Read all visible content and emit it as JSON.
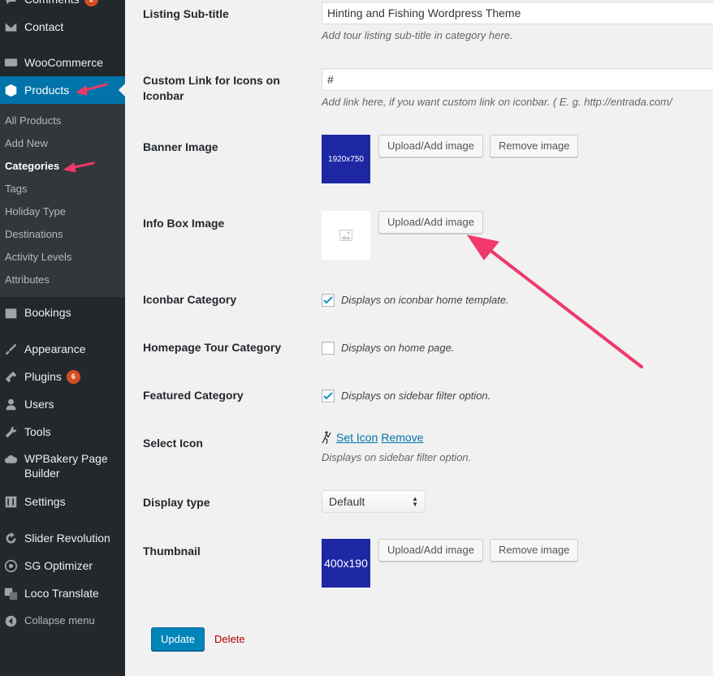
{
  "sidebar": {
    "items": [
      {
        "label": "Comments",
        "icon": "comment-icon",
        "badge": "1"
      },
      {
        "label": "Contact",
        "icon": "envelope-icon"
      },
      {
        "label": "WooCommerce",
        "icon": "woo-icon"
      },
      {
        "label": "Products",
        "icon": "products-icon"
      },
      {
        "label": "Bookings",
        "icon": "calendar-icon"
      },
      {
        "label": "Appearance",
        "icon": "brush-icon"
      },
      {
        "label": "Plugins",
        "icon": "plugin-icon",
        "badge": "6"
      },
      {
        "label": "Users",
        "icon": "users-icon"
      },
      {
        "label": "Tools",
        "icon": "wrench-icon"
      },
      {
        "label": "WPBakery Page Builder",
        "icon": "cloud-icon"
      },
      {
        "label": "Settings",
        "icon": "settings-icon"
      },
      {
        "label": "Slider Revolution",
        "icon": "refresh-icon"
      },
      {
        "label": "SG Optimizer",
        "icon": "sg-icon"
      },
      {
        "label": "Loco Translate",
        "icon": "translate-icon"
      },
      {
        "label": "Collapse menu",
        "icon": "collapse-icon"
      }
    ],
    "submenu": [
      {
        "label": "All Products"
      },
      {
        "label": "Add New"
      },
      {
        "label": "Categories"
      },
      {
        "label": "Tags"
      },
      {
        "label": "Holiday Type"
      },
      {
        "label": "Destinations"
      },
      {
        "label": "Activity Levels"
      },
      {
        "label": "Attributes"
      }
    ]
  },
  "form": {
    "subtitle": {
      "label": "Listing Sub-title",
      "value": "Hinting and Fishing Wordpress Theme",
      "desc": "Add tour listing sub-title in category here."
    },
    "custom_link": {
      "label": "Custom Link for Icons on Iconbar",
      "value": "#",
      "desc": "Add link here, if you want custom link on iconbar. ( E. g. http://entrada.com/"
    },
    "banner": {
      "label": "Banner Image",
      "thumb_text": "1920x750",
      "upload": "Upload/Add image",
      "remove": "Remove image"
    },
    "info_box": {
      "label": "Info Box Image",
      "upload": "Upload/Add image"
    },
    "iconbar": {
      "label": "Iconbar Category",
      "checked": true,
      "desc": "Displays on iconbar home template."
    },
    "homepage": {
      "label": "Homepage Tour Category",
      "checked": false,
      "desc": "Displays on home page."
    },
    "featured": {
      "label": "Featured Category",
      "checked": true,
      "desc": "Displays on sidebar filter option."
    },
    "select_icon": {
      "label": "Select Icon",
      "set": "Set Icon",
      "remove": "Remove",
      "desc": "Displays on sidebar filter option."
    },
    "display_type": {
      "label": "Display type",
      "value": "Default"
    },
    "thumbnail": {
      "label": "Thumbnail",
      "thumb_text": "400x190",
      "upload": "Upload/Add image",
      "remove": "Remove image"
    },
    "update": "Update",
    "delete": "Delete"
  },
  "colors": {
    "sidebar_bg": "#23282d",
    "accent": "#0073aa",
    "annotation": "#f0386b",
    "placeholder_blue": "#1e28a4"
  }
}
